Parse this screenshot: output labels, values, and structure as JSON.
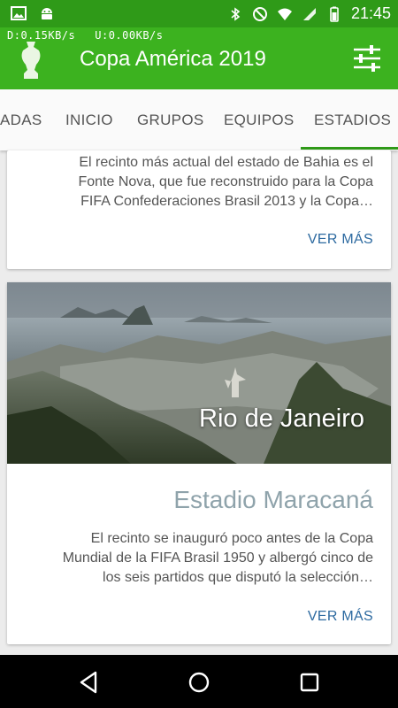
{
  "status_bar": {
    "time": "21:45",
    "icons": [
      "image-icon",
      "android-icon",
      "bluetooth-icon",
      "dnd-icon",
      "wifi-icon",
      "signal-icon",
      "battery-icon"
    ]
  },
  "network_speed": {
    "download": "D:0.15KB/s",
    "upload": "U:0.00KB/s"
  },
  "app_bar": {
    "title": "Copa América 2019",
    "logo_icon": "trophy-icon",
    "action_icon": "filter-sliders-icon"
  },
  "tabs": [
    {
      "label": "ADAS",
      "active": false
    },
    {
      "label": "INICIO",
      "active": false
    },
    {
      "label": "GRUPOS",
      "active": false
    },
    {
      "label": "EQUIPOS",
      "active": false
    },
    {
      "label": "ESTADIOS",
      "active": true
    }
  ],
  "cards": [
    {
      "description": "El recinto más actual del estado de Bahia es el Fonte Nova, que fue reconstruido para la Copa FIFA Confederaciones Brasil 2013 y la Copa…",
      "description_lines": [
        "El recinto más actual del estado de Bahia es el",
        "Fonte Nova, que fue reconstruido para la Copa",
        "FIFA Confederaciones Brasil 2013 y la Copa…"
      ],
      "action": "VER MÁS"
    },
    {
      "city": "Rio de Janeiro",
      "stadium": "Estadio Maracaná",
      "description_lines": [
        "El recinto se inauguró poco antes de la Copa",
        "Mundial de la FIFA Brasil 1950 y albergó cinco de",
        "los seis partidos que disputó la selección…"
      ],
      "action": "VER MÁS"
    }
  ],
  "colors": {
    "status_bar": "#2f9a18",
    "app_bar": "#3cb21f",
    "link": "#2d6aa0",
    "stadium_title": "#8fa3ab"
  }
}
